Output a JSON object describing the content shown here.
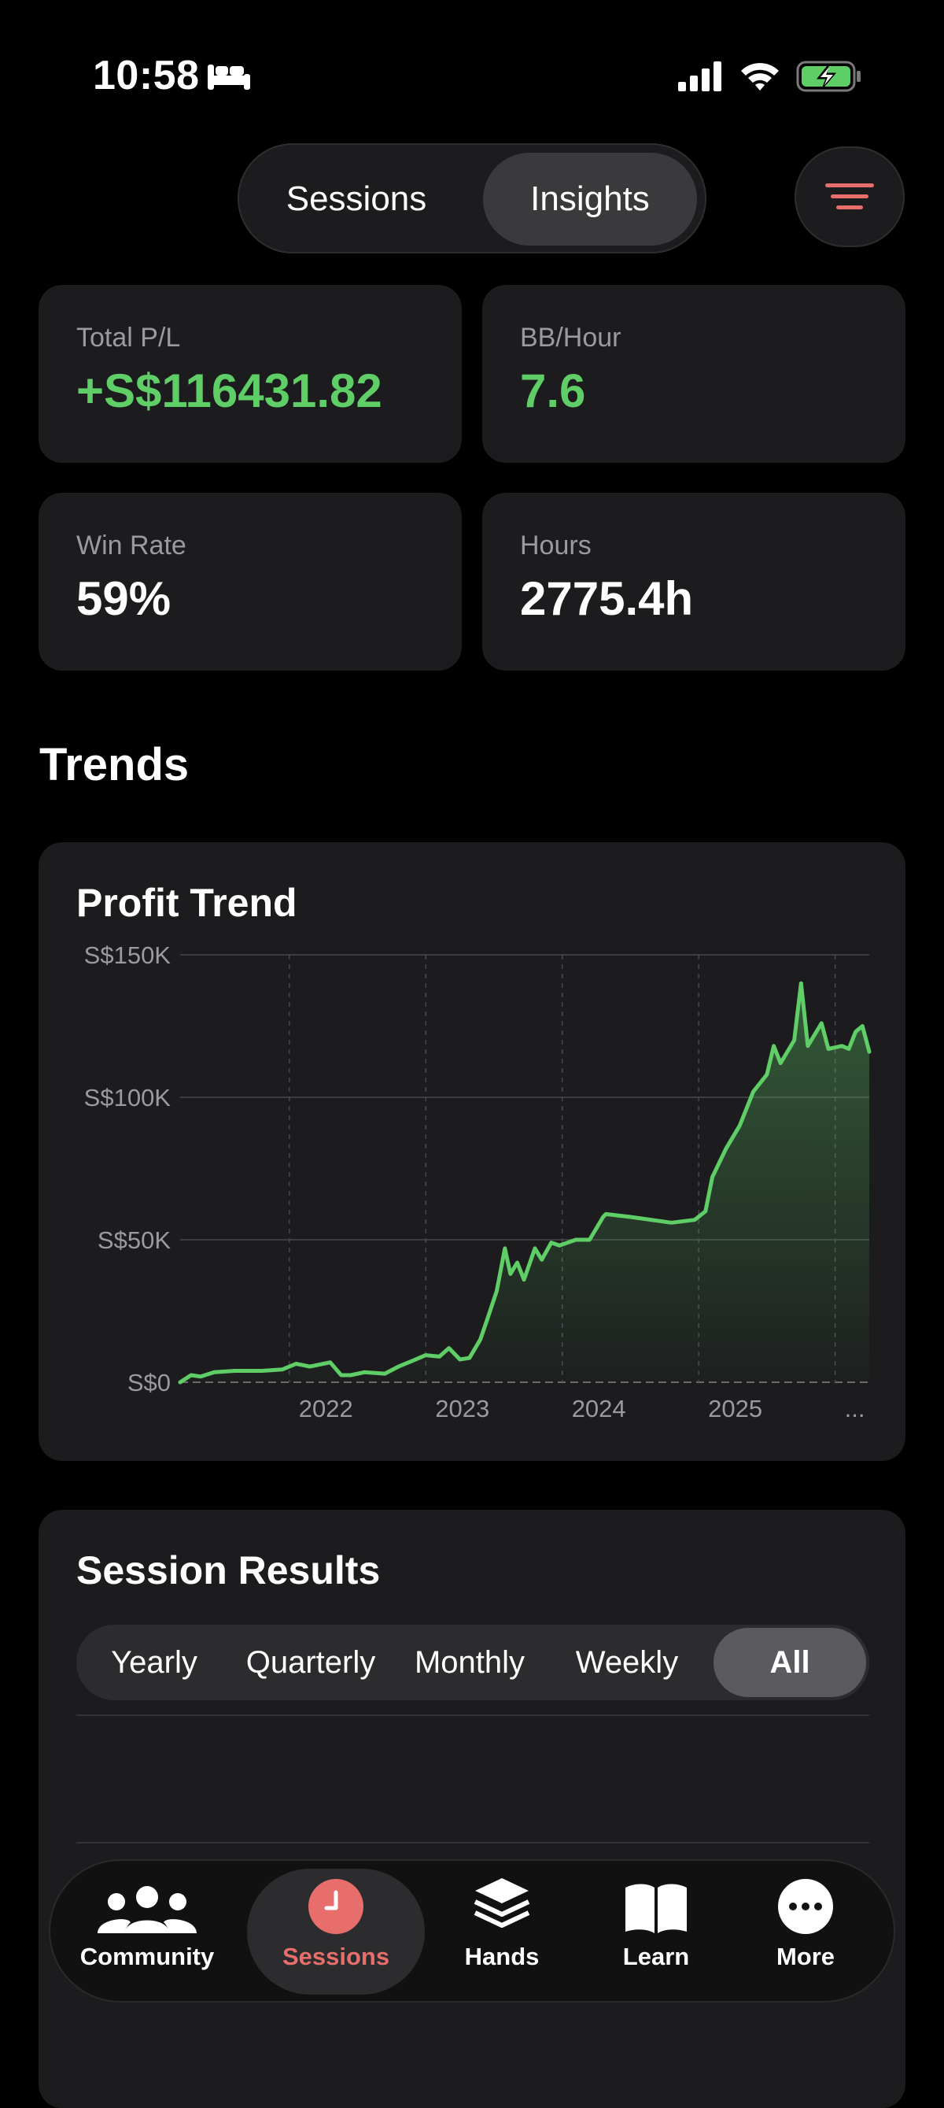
{
  "status_bar": {
    "time": "10:58"
  },
  "segment": {
    "sessions": "Sessions",
    "insights": "Insights",
    "selected": "Insights"
  },
  "stats": [
    {
      "label": "Total P/L",
      "value": "+S$116431.82",
      "color": "#5fce66"
    },
    {
      "label": "BB/Hour",
      "value": "7.6",
      "color": "#5fce66"
    },
    {
      "label": "Win Rate",
      "value": "59%",
      "color": "#ffffff"
    },
    {
      "label": "Hours",
      "value": "2775.4h",
      "color": "#ffffff"
    }
  ],
  "trends_heading": "Trends",
  "chart_data": {
    "type": "area",
    "title": "Profit Trend",
    "xlabel": "",
    "ylabel": "",
    "y_ticks": [
      "S$0",
      "S$50K",
      "S$100K",
      "S$150K"
    ],
    "ylim": [
      0,
      150000
    ],
    "x_ticks": [
      "2022",
      "2023",
      "2024",
      "2025",
      "..."
    ],
    "xlim": [
      2021.2,
      2026.25
    ],
    "grid": true,
    "line_color": "#5fce66",
    "x": [
      2021.2,
      2021.28,
      2021.35,
      2021.45,
      2021.6,
      2021.8,
      2021.95,
      2022.05,
      2022.15,
      2022.2,
      2022.3,
      2022.38,
      2022.45,
      2022.55,
      2022.7,
      2022.8,
      2022.9,
      2023.0,
      2023.1,
      2023.17,
      2023.25,
      2023.32,
      2023.4,
      2023.45,
      2023.52,
      2023.58,
      2023.62,
      2023.67,
      2023.72,
      2023.8,
      2023.85,
      2023.92,
      2023.98,
      2024.1,
      2024.2,
      2024.3,
      2024.32,
      2024.5,
      2024.8,
      2024.97,
      2025.05,
      2025.1,
      2025.2,
      2025.3,
      2025.4,
      2025.5,
      2025.55,
      2025.6,
      2025.7,
      2025.75,
      2025.8,
      2025.9,
      2025.95,
      2026.05,
      2026.1,
      2026.15,
      2026.2,
      2026.25
    ],
    "y": [
      0,
      2500,
      2000,
      3500,
      4000,
      4000,
      4500,
      6500,
      5500,
      6000,
      7000,
      2500,
      2500,
      3500,
      3000,
      5500,
      7500,
      9500,
      9000,
      12000,
      8000,
      8500,
      15000,
      22000,
      32000,
      47000,
      38000,
      42000,
      36000,
      47000,
      43000,
      49000,
      48000,
      50000,
      50000,
      58000,
      59000,
      58000,
      56000,
      57000,
      60000,
      72000,
      82000,
      90000,
      102000,
      108000,
      118000,
      112000,
      120000,
      140000,
      118000,
      126000,
      117000,
      118000,
      117000,
      123000,
      125000,
      116000
    ]
  },
  "results": {
    "title": "Session Results",
    "periods": [
      "Yearly",
      "Quarterly",
      "Monthly",
      "Weekly",
      "All"
    ],
    "selected": "All"
  },
  "tabs": [
    {
      "label": "Community",
      "icon": "community-icon"
    },
    {
      "label": "Sessions",
      "icon": "sessions-clock-icon",
      "active": true
    },
    {
      "label": "Hands",
      "icon": "hands-stack-icon"
    },
    {
      "label": "Learn",
      "icon": "book-icon"
    },
    {
      "label": "More",
      "icon": "more-icon"
    }
  ],
  "colors": {
    "accent": "#e86e6c",
    "positive": "#5fce66",
    "card": "#1c1c1e"
  }
}
